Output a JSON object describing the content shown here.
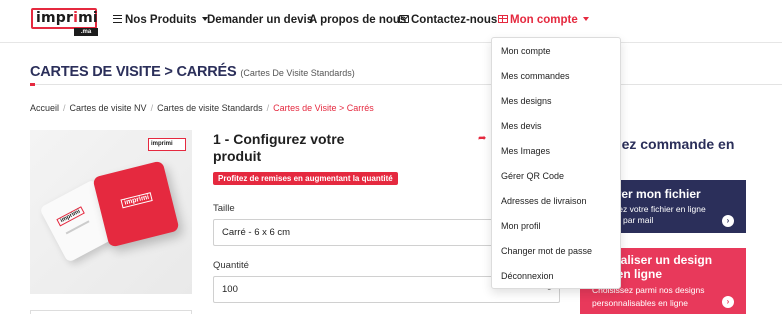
{
  "nav": {
    "logo_main": "impr",
    "logo_accent": "i",
    "logo_rest": "mi",
    "logo_suffix": ".ma",
    "products": "Nos Produits",
    "devis": "Demander un devis",
    "about": "A propos de nous",
    "contact": "Contactez-nous",
    "account": "Mon compte"
  },
  "title": {
    "main": "CARTES DE VISITE > CARRÉS",
    "sub": "(Cartes De Visite Standards)"
  },
  "breadcrumb": {
    "items": [
      "Accueil",
      "Cartes de visite NV",
      "Cartes de visite Standards"
    ],
    "current": "Cartes de Visite > Carrés",
    "separator": "/"
  },
  "product_image": {
    "logo_text": "imprimi",
    "card_white_text": "imprimi",
    "card_red_text": "imprimi"
  },
  "config": {
    "title": "1 - Configurez votre produit",
    "promo": "Profitez de remises en augmentant la quantité",
    "size_label": "Taille",
    "size_value": "Carré - 6 x 6 cm",
    "qty_label": "Quantité",
    "qty_value": "100",
    "qty_minus": "-"
  },
  "right": {
    "heading": "ssez commande en",
    "panel1_title": "férer mon fichier",
    "panel1_line1": "argez votre fichier en ligne",
    "panel1_line2": "tard par mail",
    "panel2_title": "nnaliser un design",
    "panel2_title2": "it en ligne",
    "panel2_line1": "Choisissez parmi nos designs",
    "panel2_line2": "personnalisables en ligne"
  },
  "dropdown": {
    "items": [
      "Mon compte",
      "Mes commandes",
      "Mes designs",
      "Mes devis",
      "Mes Images",
      "Gérer QR Code",
      "Adresses de livraison",
      "Mon profil",
      "Changer mot de passe",
      "Déconnexion"
    ]
  },
  "colors": {
    "brand_red": "#e5293f",
    "navy": "#2b2f5a",
    "pink": "#e8395b"
  }
}
